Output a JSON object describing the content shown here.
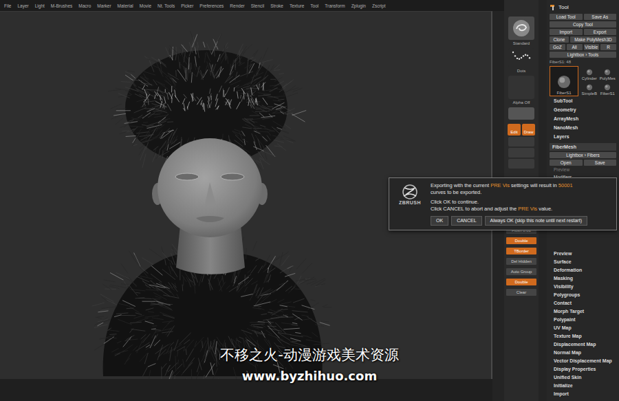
{
  "menu_bar": [
    "File",
    "Layer",
    "Light",
    "M-Brushes",
    "Macro",
    "Marker",
    "Material",
    "Movie",
    "Nt. Tools",
    "Picker",
    "Preferences",
    "Render",
    "Stencil",
    "Stroke",
    "Texture",
    "Tool",
    "Transform",
    "Zplugin",
    "Zscript"
  ],
  "shelf": {
    "brush": "Standard",
    "stroke": "Dots",
    "alpha": "Alpha Off",
    "modes": [
      {
        "label": "Edit",
        "selected": true
      },
      {
        "label": "Draw",
        "selected": true
      }
    ],
    "tools": [
      {
        "label": "Flush 0.02",
        "selected": false
      },
      {
        "label": "Double",
        "selected": true
      },
      {
        "label": "TBorder",
        "selected": true
      },
      {
        "label": "Del Hidden",
        "selected": false
      },
      {
        "label": "Auto Group",
        "selected": false
      },
      {
        "label": "Double",
        "selected": true
      },
      {
        "label": "Clear",
        "selected": false
      }
    ]
  },
  "tool_panel": {
    "title": "Tool",
    "button_rows": [
      [
        {
          "label": "Load Tool"
        },
        {
          "label": "Save As"
        }
      ],
      [
        {
          "label": "Copy Tool"
        }
      ],
      [
        {
          "label": "Import"
        },
        {
          "label": "Export"
        }
      ],
      [
        {
          "label": "Clone"
        },
        {
          "label": "Make PolyMesh3D"
        }
      ],
      [
        {
          "label": "GoZ"
        },
        {
          "label": "All"
        },
        {
          "label": "Visible"
        },
        {
          "label": "R"
        }
      ],
      [
        {
          "label": "Lightbox › Tools"
        }
      ]
    ],
    "current": "FiberS1: 48",
    "thumbnails": [
      {
        "label": "FiberS1",
        "selected": true
      },
      {
        "label": "Cylinder",
        "selected": false
      },
      {
        "label": "PolyMes",
        "selected": false
      },
      {
        "label": "SimpleB",
        "selected": false
      },
      {
        "label": "FiberS1",
        "selected": false
      }
    ],
    "sections_top": [
      "SubTool",
      "Geometry",
      "ArrayMesh",
      "NanoMesh",
      "Layers"
    ],
    "fibermesh": {
      "title": "FiberMesh",
      "lightbox": "Lightbox › Fibers",
      "buttons": [
        "Open",
        "Save"
      ],
      "items": [
        {
          "label": "Preview",
          "disabled": true
        },
        {
          "label": "Modifiers",
          "disabled": false
        }
      ]
    },
    "sections_bottom": [
      "Preview",
      "Surface",
      "Deformation",
      "Masking",
      "Visibility",
      "Polygroups",
      "Contact",
      "Morph Target",
      "Polypaint",
      "UV Map",
      "Texture Map",
      "Displacement Map",
      "Normal Map",
      "Vector Displacement Map",
      "Display Properties",
      "Unified Skin",
      "Initialize",
      "Import"
    ]
  },
  "dialog": {
    "logo": "ZBRUSH",
    "paragraphs": [
      [
        [
          {
            "text": "Exporting with the current ",
            "highlight": false
          },
          {
            "text": "PRE Vis",
            "highlight": true
          },
          {
            "text": " settings will result in ",
            "highlight": false
          },
          {
            "text": "50001",
            "highlight": true
          }
        ],
        [
          {
            "text": "curves to be exported.",
            "highlight": false
          }
        ]
      ],
      [
        [
          {
            "text": "Click OK to continue.",
            "highlight": false
          }
        ],
        [
          {
            "text": "Click CANCEL to abort and adjust the ",
            "highlight": false
          },
          {
            "text": "PRE Vis",
            "highlight": true
          },
          {
            "text": " value.",
            "highlight": false
          }
        ]
      ]
    ],
    "buttons": [
      {
        "label": "OK"
      },
      {
        "label": "CANCEL"
      },
      {
        "label": "Always OK (skip this note until next restart)"
      }
    ]
  },
  "watermark": {
    "title": "不移之火-动漫游戏美术资源",
    "url": "www.byzhihuo.com"
  }
}
